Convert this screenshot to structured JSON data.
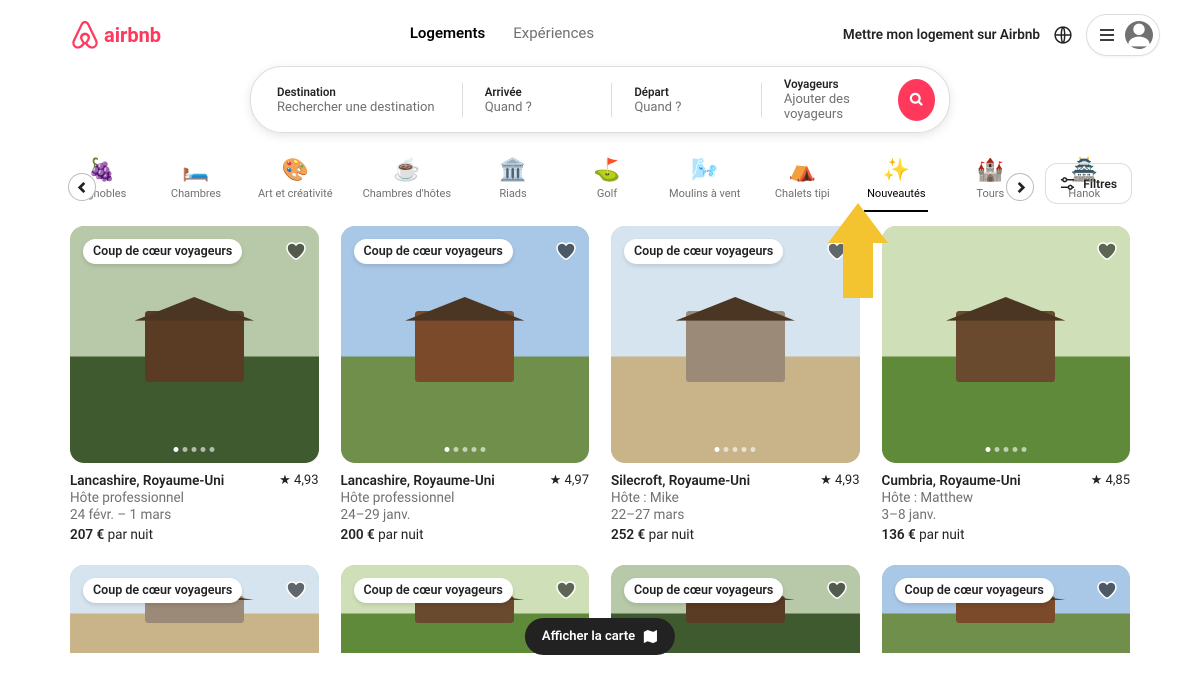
{
  "brand": "airbnb",
  "nav": {
    "tab1": "Logements",
    "tab2": "Expériences"
  },
  "header": {
    "host": "Mettre mon logement sur Airbnb"
  },
  "search": {
    "dest_label": "Destination",
    "dest_value": "Rechercher une destination",
    "arr_label": "Arrivée",
    "arr_value": "Quand ?",
    "dep_label": "Départ",
    "dep_value": "Quand ?",
    "voy_label": "Voyageurs",
    "voy_value": "Ajouter des voyageurs"
  },
  "categories": [
    {
      "label": "Vignobles",
      "icon": "🍇"
    },
    {
      "label": "Chambres",
      "icon": "🛏️"
    },
    {
      "label": "Art et créativité",
      "icon": "🎨"
    },
    {
      "label": "Chambres d'hôtes",
      "icon": "☕"
    },
    {
      "label": "Riads",
      "icon": "🏛️"
    },
    {
      "label": "Golf",
      "icon": "⛳"
    },
    {
      "label": "Moulins à vent",
      "icon": "🌬️"
    },
    {
      "label": "Chalets tipi",
      "icon": "⛺"
    },
    {
      "label": "Nouveautés",
      "icon": "✨",
      "active": true
    },
    {
      "label": "Tours",
      "icon": "🏰"
    },
    {
      "label": "Hanok",
      "icon": "🏯"
    }
  ],
  "filters_label": "Filtres",
  "listings": [
    {
      "title": "Lancashire, Royaume-Uni",
      "rating": "4,93",
      "host": "Hôte professionnel",
      "dates": "24 févr. – 1 mars",
      "price": "207 €",
      "per": "par nuit",
      "badge": "Coup de cœur voyageurs"
    },
    {
      "title": "Lancashire, Royaume-Uni",
      "rating": "4,97",
      "host": "Hôte professionnel",
      "dates": "24–29 janv.",
      "price": "200 €",
      "per": "par nuit",
      "badge": "Coup de cœur voyageurs"
    },
    {
      "title": "Silecroft, Royaume-Uni",
      "rating": "4,93",
      "host": "Hôte : Mike",
      "dates": "22–27 mars",
      "price": "252 €",
      "per": "par nuit",
      "badge": "Coup de cœur voyageurs"
    },
    {
      "title": "Cumbria, Royaume-Uni",
      "rating": "4,85",
      "host": "Hôte : Matthew",
      "dates": "3–8 janv.",
      "price": "136 €",
      "per": "par nuit",
      "badge": ""
    }
  ],
  "listings_row2": [
    {
      "badge": "Coup de cœur voyageurs"
    },
    {
      "badge": "Coup de cœur voyageurs"
    },
    {
      "badge": "Coup de cœur voyageurs"
    },
    {
      "badge": "Coup de cœur voyageurs"
    }
  ],
  "map_button": "Afficher la carte",
  "colors": {
    "brand": "#ff385c",
    "anno": "#f4c430"
  }
}
